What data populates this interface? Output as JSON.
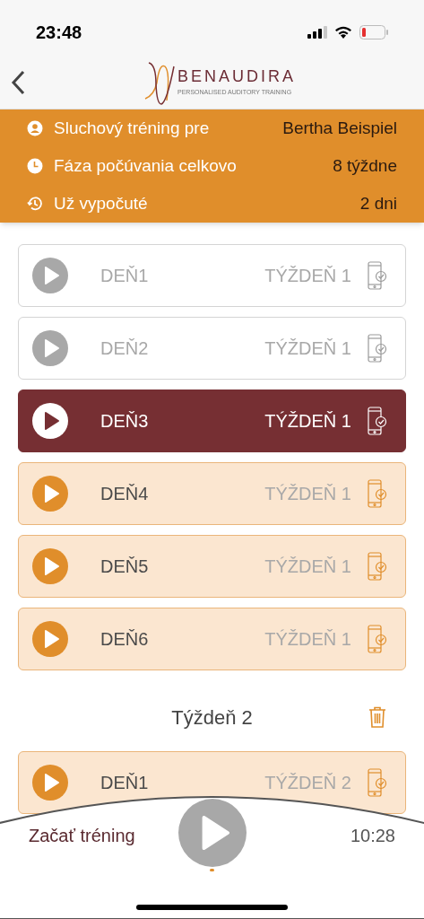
{
  "status_bar": {
    "time": "23:48"
  },
  "header": {
    "brand": "BENAUDIRA",
    "tagline": "PERSONALISED AUDITORY TRAINING"
  },
  "summary": [
    {
      "kind": "user",
      "label": "Sluchový tréning pre",
      "value": "Bertha Beispiel"
    },
    {
      "kind": "clock",
      "label": "Fáza počúvania celkovo",
      "value": "8 týždne"
    },
    {
      "kind": "history",
      "label": "Už vypočuté",
      "value": "2 dni"
    }
  ],
  "weeks": [
    {
      "days": [
        {
          "kind": "done",
          "day": "DEŇ1",
          "week": "TÝŽDEŇ 1"
        },
        {
          "kind": "done",
          "day": "DEŇ2",
          "week": "TÝŽDEŇ 1"
        },
        {
          "kind": "current",
          "day": "DEŇ3",
          "week": "TÝŽDEŇ 1"
        },
        {
          "kind": "upcoming",
          "day": "DEŇ4",
          "week": "TÝŽDEŇ 1"
        },
        {
          "kind": "upcoming",
          "day": "DEŇ5",
          "week": "TÝŽDEŇ 1"
        },
        {
          "kind": "upcoming",
          "day": "DEŇ6",
          "week": "TÝŽDEŇ 1"
        }
      ]
    },
    {
      "title": "Týždeň 2",
      "days": [
        {
          "kind": "upcoming",
          "day": "DEŇ1",
          "week": "TÝŽDEŇ 2"
        }
      ]
    }
  ],
  "player": {
    "label": "Začať tréning",
    "time": "10:28"
  }
}
